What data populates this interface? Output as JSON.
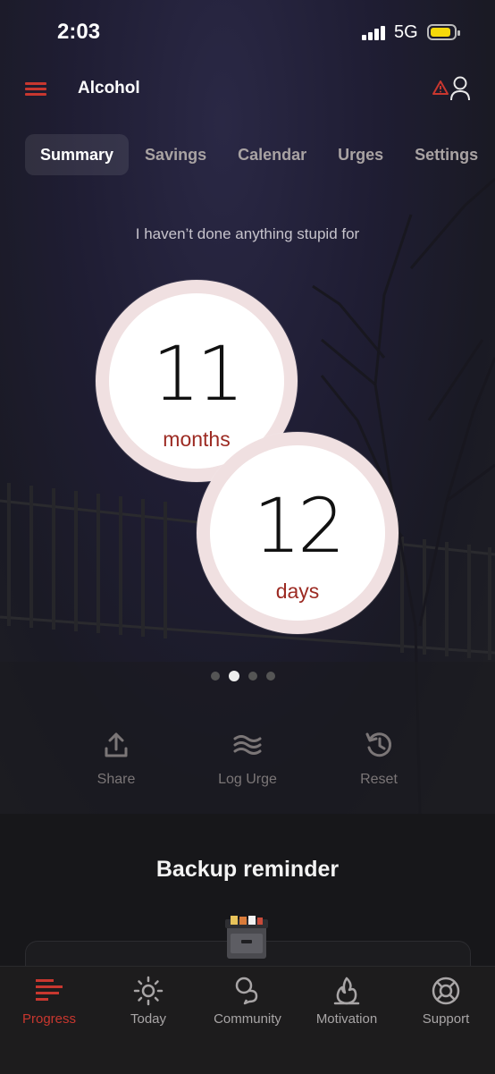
{
  "status_bar": {
    "time": "2:03",
    "network": "5G"
  },
  "header": {
    "title": "Alcohol"
  },
  "tabs": [
    {
      "label": "Summary",
      "active": true
    },
    {
      "label": "Savings",
      "active": false
    },
    {
      "label": "Calendar",
      "active": false
    },
    {
      "label": "Urges",
      "active": false
    },
    {
      "label": "Settings",
      "active": false
    }
  ],
  "summary": {
    "subtitle": "I haven’t done anything stupid for",
    "counter1": {
      "value": "11",
      "unit": "months"
    },
    "counter2": {
      "value": "12",
      "unit": "days"
    },
    "pager": {
      "total": 4,
      "active": 1
    }
  },
  "actions": {
    "share": "Share",
    "log_urge": "Log Urge",
    "reset": "Reset"
  },
  "backup": {
    "title": "Backup reminder"
  },
  "tabbar": {
    "progress": "Progress",
    "today": "Today",
    "community": "Community",
    "motivation": "Motivation",
    "support": "Support"
  },
  "colors": {
    "accent": "#c8372f",
    "circle_ring": "#f0e0e1",
    "unit_text": "#9c2a22"
  }
}
